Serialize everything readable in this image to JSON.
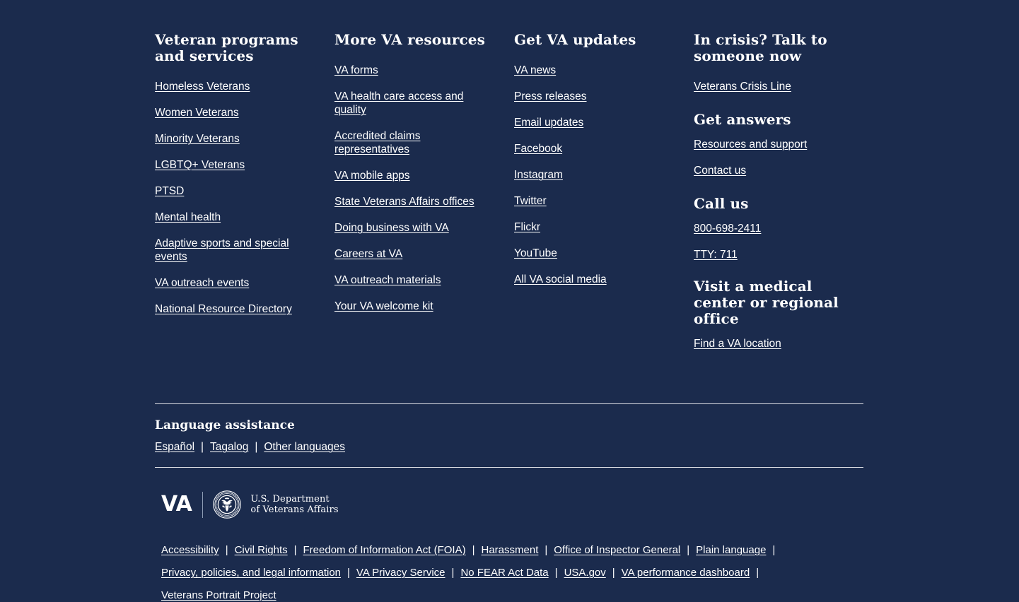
{
  "colors": {
    "background": "#1b2b4d",
    "text": "#ffffff",
    "divider": "#ffffff",
    "logo_rule": "#8d9cb5"
  },
  "columns": [
    {
      "heading": "Veteran programs and services",
      "links": [
        "Homeless Veterans",
        "Women Veterans",
        "Minority Veterans",
        "LGBTQ+ Veterans",
        "PTSD",
        "Mental health",
        "Adaptive sports and special events",
        "VA outreach events",
        "National Resource Directory"
      ]
    },
    {
      "heading": "More VA resources",
      "links": [
        "VA forms",
        "VA health care access and quality",
        "Accredited claims representatives",
        "VA mobile apps",
        "State Veterans Affairs offices",
        "Doing business with VA",
        "Careers at VA",
        "VA outreach materials",
        "Your VA welcome kit"
      ]
    },
    {
      "heading": "Get VA updates",
      "links": [
        "VA news",
        "Press releases",
        "Email updates",
        "Facebook",
        "Instagram",
        "Twitter",
        "Flickr",
        "YouTube",
        "All VA social media"
      ]
    }
  ],
  "crisis_column": {
    "crisis_heading": "In crisis? Talk to someone now",
    "crisis_link": "Veterans Crisis Line",
    "answers_heading": "Get answers",
    "answers_links": [
      "Resources and support",
      "Contact us"
    ],
    "call_heading": "Call us",
    "call_links": [
      "800-698-2411",
      "TTY: 711"
    ],
    "visit_heading": "Visit a medical center or regional office",
    "visit_link": "Find a VA location"
  },
  "language_assistance": {
    "heading": "Language assistance",
    "links": [
      "Español",
      "Tagalog",
      "Other languages"
    ],
    "separator": "|"
  },
  "logo": {
    "wordmark": "VA",
    "seal_name": "va-seal-eagle",
    "department_line_1": "U.S. Department",
    "department_line_2": "of Veterans Affairs"
  },
  "legal_links": {
    "separator": "|",
    "rows": [
      [
        "Accessibility",
        "Civil Rights",
        "Freedom of Information Act (FOIA)",
        "Harassment",
        "Office of Inspector General",
        "Plain language"
      ],
      [
        "Privacy, policies, and legal information",
        "VA Privacy Service",
        "No FEAR Act Data",
        "USA.gov",
        "VA performance dashboard"
      ],
      [
        "Veterans Portrait Project"
      ]
    ]
  }
}
